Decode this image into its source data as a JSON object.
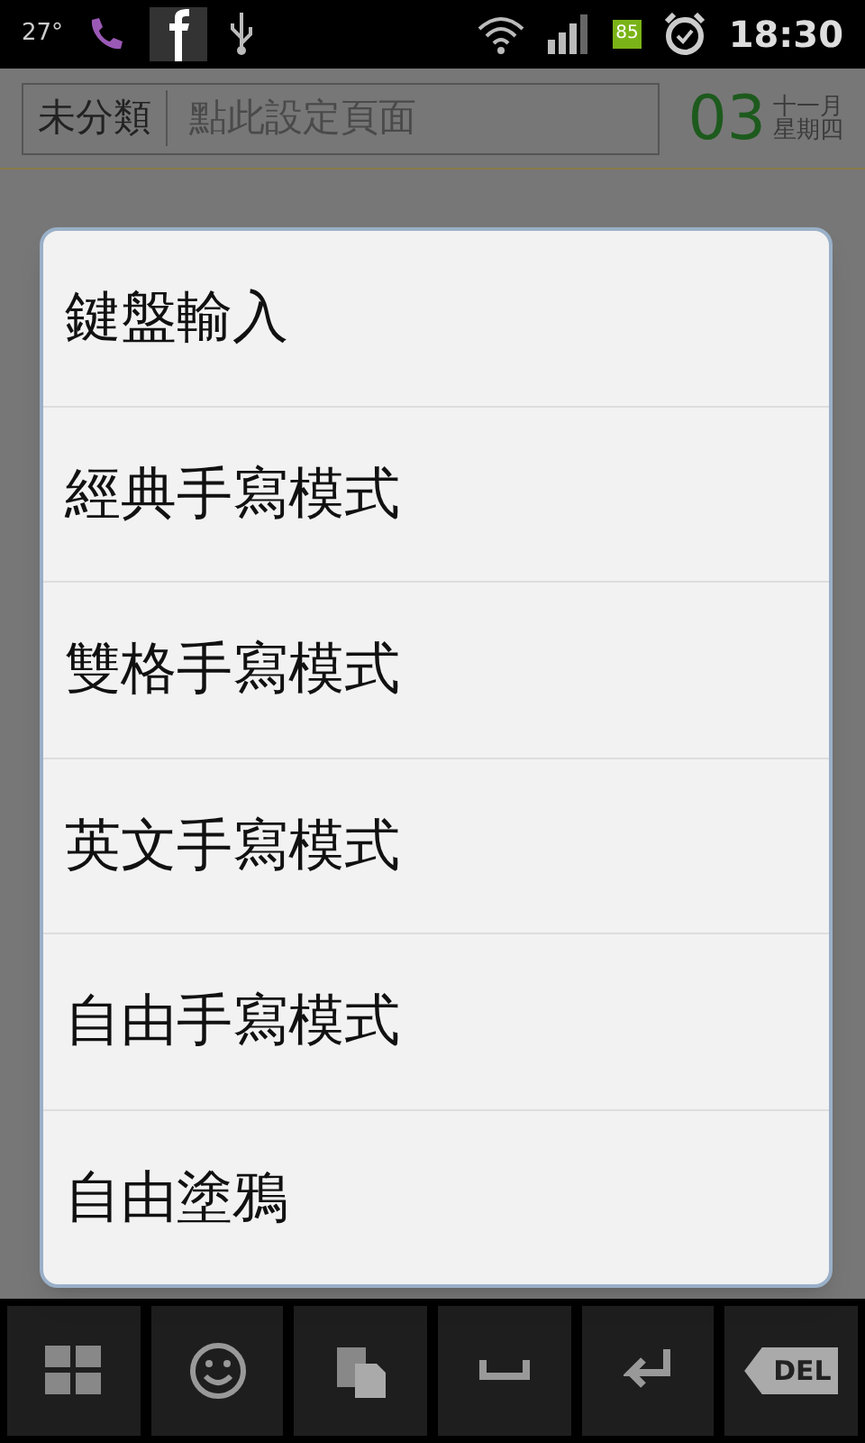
{
  "status_bar": {
    "temperature": "27°",
    "time": "18:30",
    "battery": "85"
  },
  "header": {
    "category": "未分類",
    "page_placeholder": "點此設定頁面",
    "day": "03",
    "month": "十一月",
    "weekday": "星期四"
  },
  "menu": {
    "items": [
      "鍵盤輸入",
      "經典手寫模式",
      "雙格手寫模式",
      "英文手寫模式",
      "自由手寫模式",
      "自由塗鴉"
    ]
  },
  "keys": [
    {
      "kind": "apps"
    },
    {
      "kind": "emoji"
    },
    {
      "kind": "paste"
    },
    {
      "kind": "space"
    },
    {
      "kind": "enter"
    },
    {
      "kind": "del",
      "label": "DEL"
    }
  ]
}
